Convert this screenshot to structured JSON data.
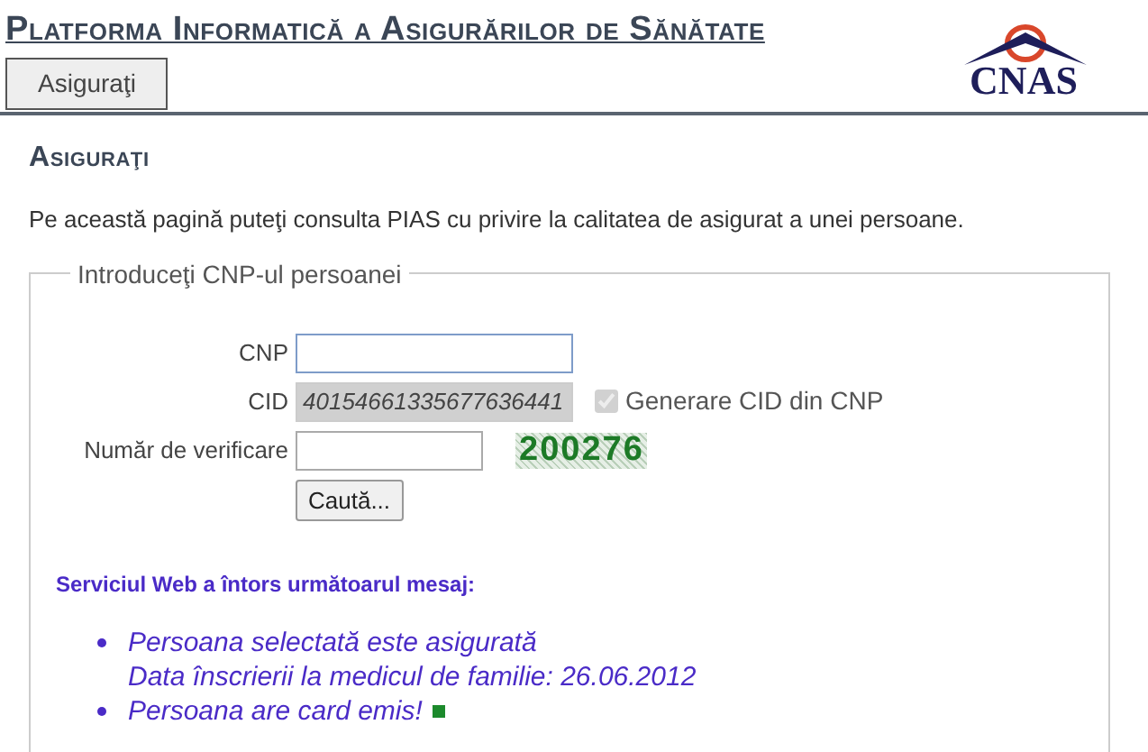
{
  "header": {
    "title": "Platforma Informatică a Asigurărilor de Sănătate",
    "nav_button": "Asiguraţi",
    "logo": "CNAS"
  },
  "page": {
    "heading": "Asiguraţi",
    "description": "Pe această pagină puteţi consulta PIAS cu privire la calitatea de asigurat a unei persoane."
  },
  "form": {
    "legend": "Introduceţi CNP-ul persoanei",
    "cnp": {
      "label": "CNP",
      "focused": true
    },
    "cid": {
      "label": "CID",
      "value": "40154661335677636441",
      "disabled": true
    },
    "generate": {
      "label": "Generare CID din CNP",
      "checked": true,
      "disabled": true
    },
    "verification": {
      "label": "Număr de verificare",
      "code": "200276"
    },
    "search_button": "Caută..."
  },
  "response": {
    "heading": "Serviciul Web a întors următoarul mesaj:",
    "messages": [
      {
        "lines": [
          "Persoana selectată este asigurată",
          "Data înscrierii la medicul de familie: 26.06.2012"
        ],
        "marker": false
      },
      {
        "lines": [
          "Persoana are card emis!"
        ],
        "marker": true
      }
    ]
  }
}
